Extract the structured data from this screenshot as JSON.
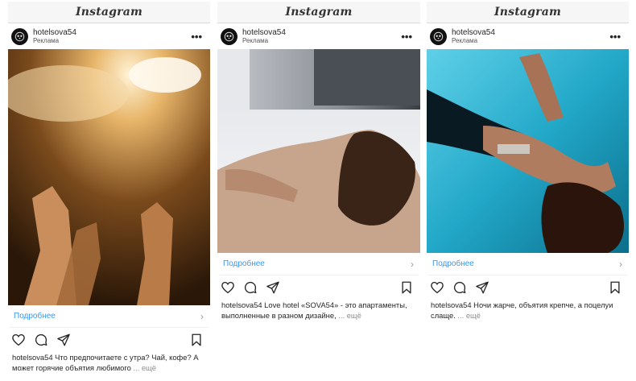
{
  "app_name": "Instagram",
  "colors": {
    "link": "#3897f0",
    "muted": "#8e8e8e",
    "text": "#262626"
  },
  "posts": [
    {
      "username": "hotelsova54",
      "sponsored_label": "Реклама",
      "more_icon": "more-icon",
      "cta_label": "Подробнее",
      "caption_user": "hotelsova54",
      "caption_text": "Что предпочитаете с утра? Чай, кофе? А может горячие объятия любимого",
      "caption_more": "... ещё"
    },
    {
      "username": "hotelsova54",
      "sponsored_label": "Реклама",
      "more_icon": "more-icon",
      "cta_label": "Подробнее",
      "caption_user": "hotelsova54",
      "caption_text": "Love hotel «SOVA54» - это апартаменты, выполненные в разном дизайне,",
      "caption_more": "... ещё"
    },
    {
      "username": "hotelsova54",
      "sponsored_label": "Реклама",
      "more_icon": "more-icon",
      "cta_label": "Подробнее",
      "caption_user": "hotelsova54",
      "caption_text": "Ночи жарче, объятия крепче, а поцелуи слаще.",
      "caption_more": "... ещё"
    }
  ]
}
